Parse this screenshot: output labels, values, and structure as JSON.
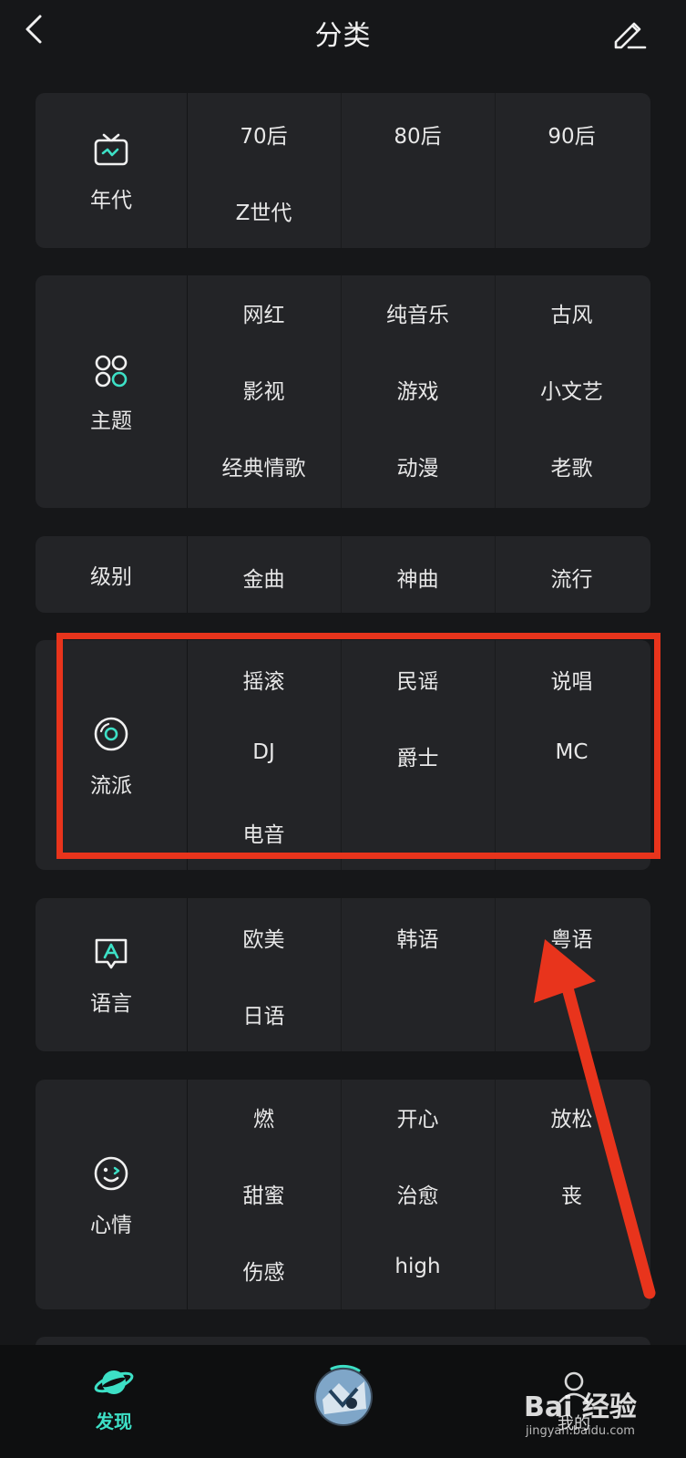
{
  "header": {
    "title": "分类"
  },
  "categories": [
    {
      "label": "年代",
      "icon": "tv-icon",
      "items": [
        "70后",
        "80后",
        "90后",
        "Z世代"
      ]
    },
    {
      "label": "主题",
      "icon": "theme-grid-icon",
      "items": [
        "网红",
        "纯音乐",
        "古风",
        "影视",
        "游戏",
        "小文艺",
        "经典情歌",
        "动漫",
        "老歌"
      ]
    },
    {
      "label": "级别",
      "icon": "",
      "items": [
        "金曲",
        "神曲",
        "流行"
      ]
    },
    {
      "label": "流派",
      "icon": "vinyl-icon",
      "items": [
        "摇滚",
        "民谣",
        "说唱",
        "DJ",
        "爵士",
        "MC",
        "电音"
      ]
    },
    {
      "label": "语言",
      "icon": "language-bubble-icon",
      "items": [
        "欧美",
        "韩语",
        "粤语",
        "日语"
      ]
    },
    {
      "label": "心情",
      "icon": "smile-icon",
      "items": [
        "燃",
        "开心",
        "放松",
        "甜蜜",
        "治愈",
        "丧",
        "伤感",
        "high"
      ]
    }
  ],
  "tabbar": {
    "discover_label": "发现",
    "mine_label": "我的"
  },
  "watermark": {
    "logo": "Bai 经验",
    "sub": "jingyan.baidu.com"
  },
  "colors": {
    "accent": "#3de0c6",
    "highlight": "#e8341c",
    "card_bg": "#232427",
    "page_bg": "#161719"
  }
}
